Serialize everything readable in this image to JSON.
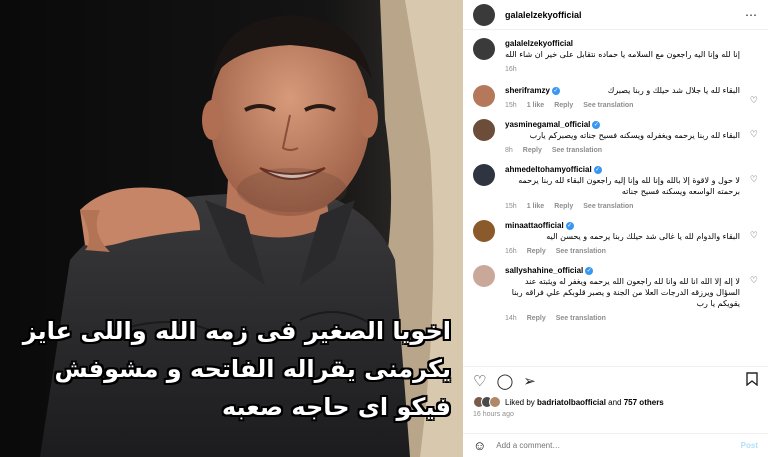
{
  "photo": {
    "caption_lines": [
      "اخويا الصغير فى زمه الله واللى عايز",
      "يكرمنى يقراله الفاتحه و مشوفش",
      "فيكو اى حاجه صعبه"
    ]
  },
  "post": {
    "author": "galalelzekyofficial",
    "more_icon": "⋯"
  },
  "comments": [
    {
      "user": "galalelzekyofficial",
      "verified": false,
      "text": "إنا لله وإنا اليه راجعون مع السلامه يا حماده نتقابل على خير ان شاء الله",
      "time": "16h",
      "likes": "",
      "reply": "",
      "translate": "",
      "avatar_color": "#3a3a3a"
    },
    {
      "user": "sheriframzy",
      "verified": true,
      "text": "البقاء لله يا جلال شد حيلك و ربنا يصبرك",
      "time": "15h",
      "likes": "1 like",
      "reply": "Reply",
      "translate": "See translation",
      "avatar_color": "#b5785a"
    },
    {
      "user": "yasminegamal_official",
      "verified": true,
      "text": "البقاء لله ربنا يرحمه ويغفرله ويسكنه فسيح جناته ويصبركم يارب",
      "time": "8h",
      "likes": "",
      "reply": "Reply",
      "translate": "See translation",
      "avatar_color": "#6b4d3a"
    },
    {
      "user": "ahmedeltohamyofficial",
      "verified": true,
      "text": "لا حول و لاقوة إلا بالله وإنا لله وإنا إليه راجعون البقاء لله ربنا يرحمه برحمته الواسعه ويسكنه فسيح جناته",
      "time": "15h",
      "likes": "1 like",
      "reply": "Reply",
      "translate": "See translation",
      "avatar_color": "#2e3440"
    },
    {
      "user": "minaattaofficial",
      "verified": true,
      "text": "البقاء والدوام لله يا غالى شد حيلك ربنا يرحمه و يحسن اليه",
      "time": "16h",
      "likes": "",
      "reply": "Reply",
      "translate": "See translation",
      "avatar_color": "#8a5a2b"
    },
    {
      "user": "sallyshahine_official",
      "verified": true,
      "text": "لا إله إلا الله انا لله وانا لله راجعون الله يرحمه ويغفر له ويثبته عند السؤال ويرزقه الدرجات العلا من الجنة و يصبر قلوبكم علي فراقه ربنا يقويكم يا رب",
      "time": "14h",
      "likes": "",
      "reply": "Reply",
      "translate": "See translation",
      "avatar_color": "#c9a89a"
    }
  ],
  "actions": {
    "like_icon": "♡",
    "comment_icon": "◯",
    "share_icon": "➢",
    "save_icon": "🔖"
  },
  "likes": {
    "prefix": "Liked by ",
    "user": "badriatolbaofficial",
    "middle": " and ",
    "others": "757 others"
  },
  "post_time": "16 hours ago",
  "add_comment": {
    "emoji_icon": "☺",
    "placeholder": "Add a comment…",
    "post_label": "Post"
  },
  "colors": {
    "link_blue": "#3897f0",
    "post_disabled": "#b2dffc",
    "meta_gray": "#8e8e8e"
  }
}
